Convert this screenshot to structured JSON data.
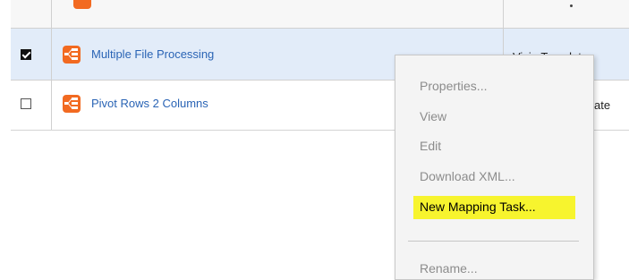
{
  "rows": [
    {
      "name": "Multiple File Processing",
      "type": "Visio Template",
      "checked": true,
      "icon": "mapping-template-icon"
    },
    {
      "name": "Pivot Rows 2 Columns",
      "type": "ate",
      "checked": false,
      "icon": "mapping-template-icon"
    }
  ],
  "context_menu": {
    "items": [
      "Properties...",
      "View",
      "Edit",
      "Download XML...",
      "New Mapping Task...",
      "Rename..."
    ],
    "highlighted_index": 4
  },
  "colors": {
    "selected_row": "#e2ecf9",
    "icon": "#f26a21",
    "highlight": "#f7f42e",
    "link": "#2a64b5"
  }
}
